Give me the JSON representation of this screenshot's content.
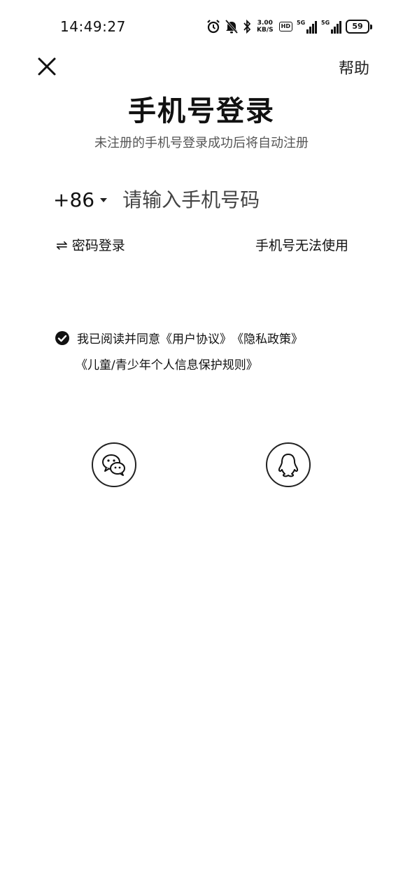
{
  "status_bar": {
    "time": "14:49:27",
    "net_speed_value": "3.00",
    "net_speed_unit": "KB/S",
    "hd_label": "HD",
    "sim1_label": "5G",
    "sim2_label": "5G",
    "battery_level": "59",
    "icons": [
      "alarm-icon",
      "mute-icon",
      "bluetooth-icon"
    ]
  },
  "header": {
    "close_icon": "close-icon",
    "help_label": "帮助"
  },
  "main": {
    "title": "手机号登录",
    "subtitle": "未注册的手机号登录成功后将自动注册",
    "country_code": "+86",
    "phone_placeholder": "请输入手机号码",
    "password_login_icon": "⇌",
    "password_login_label": "密码登录",
    "cant_use_label": "手机号无法使用"
  },
  "agreement": {
    "prefix": "我已阅读并同意",
    "user_agreement": "《用户协议》",
    "privacy_policy": "《隐私政策》",
    "child_policy": "《儿童/青少年个人信息保护规则》"
  },
  "social": {
    "items": [
      "wechat-icon",
      "qq-icon"
    ]
  }
}
